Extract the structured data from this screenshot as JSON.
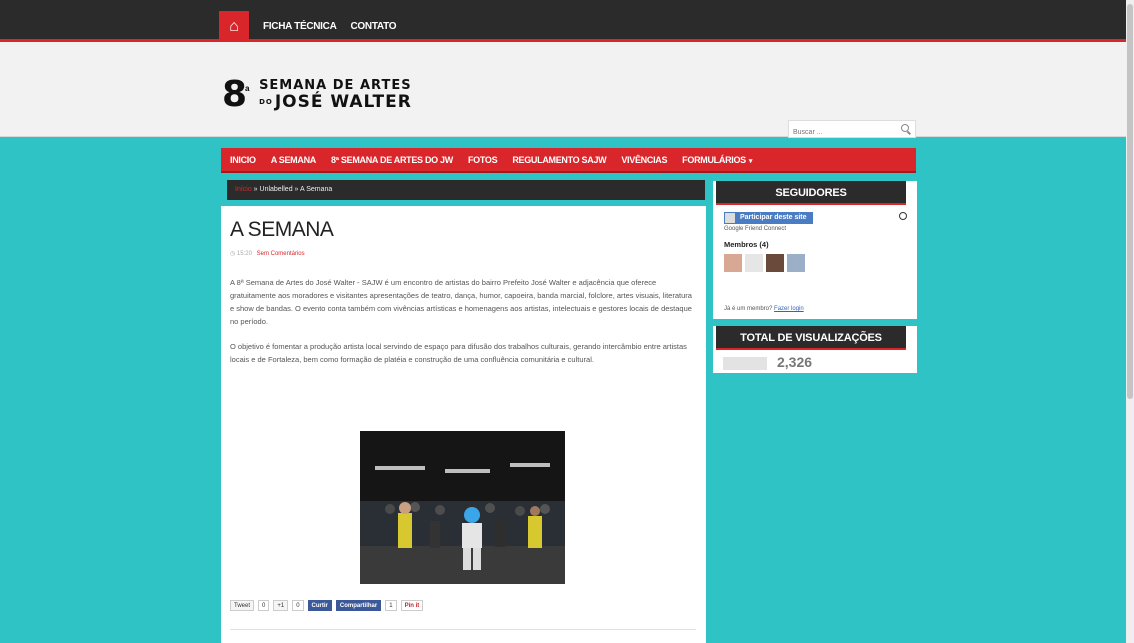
{
  "topbar": {
    "links": [
      "FICHA TÉCNICA",
      "CONTATO"
    ]
  },
  "header": {
    "logo_number": "8",
    "logo_sup": "a",
    "logo_line1": "SEMANA DE ARTES",
    "logo_line2_prefix": "DO",
    "logo_line2": "JOSÉ WALTER",
    "search_placeholder": "Buscar ..."
  },
  "nav": {
    "items": [
      "INICIO",
      "A SEMANA",
      "8ª SEMANA DE ARTES DO JW",
      "FOTOS",
      "REGULAMENTO SAJW",
      "VIVÊNCIAS",
      "FORMULÁRIOS"
    ]
  },
  "breadcrumb": {
    "home": "Início",
    "rest": " » Unlabelled » A Semana"
  },
  "post": {
    "title": "A SEMANA",
    "time": "15:20",
    "comments": "Sem Comentários",
    "paragraphs": [
      "A 8ª Semana de Artes do José Walter - SAJW é um encontro de artistas do bairro Prefeito José Walter e adjacência que oferece gratuitamente aos moradores e visitantes apresentações de teatro, dança, humor, capoeira, banda marcial, folclore, artes visuais, literatura e show de bandas. O evento conta também com vivências artísticas e homenagens aos artistas, intelectuais e gestores locais de destaque no período.",
      "O objetivo é fomentar a produção artista local servindo de espaço para difusão dos trabalhos culturais, gerando intercâmbio entre artistas locais e de Fortaleza, bem como formação de platéia e construção de uma confluência comunitária e cultural."
    ],
    "share": {
      "tweet": "Tweet",
      "tweet_count": "0",
      "gplus": "+1",
      "gplus_count": "0",
      "fb_like": "Curtir",
      "fb_share": "Compartilhar",
      "fb_count": "1",
      "pin": "Pin it"
    }
  },
  "sidebar": {
    "followers_title": "SEGUIDORES",
    "join_label": "Participar deste site",
    "gfc_label": "Google Friend Connect",
    "members_label": "Membros (4)",
    "already_member": "Já é um membro?",
    "login_link": "Fazer login",
    "views_title": "TOTAL DE VISUALIZAÇÕES",
    "views_count": "2,326"
  },
  "colors": {
    "accent": "#d9262b",
    "dark": "#2b2b2b",
    "background": "#2fc3c6"
  }
}
